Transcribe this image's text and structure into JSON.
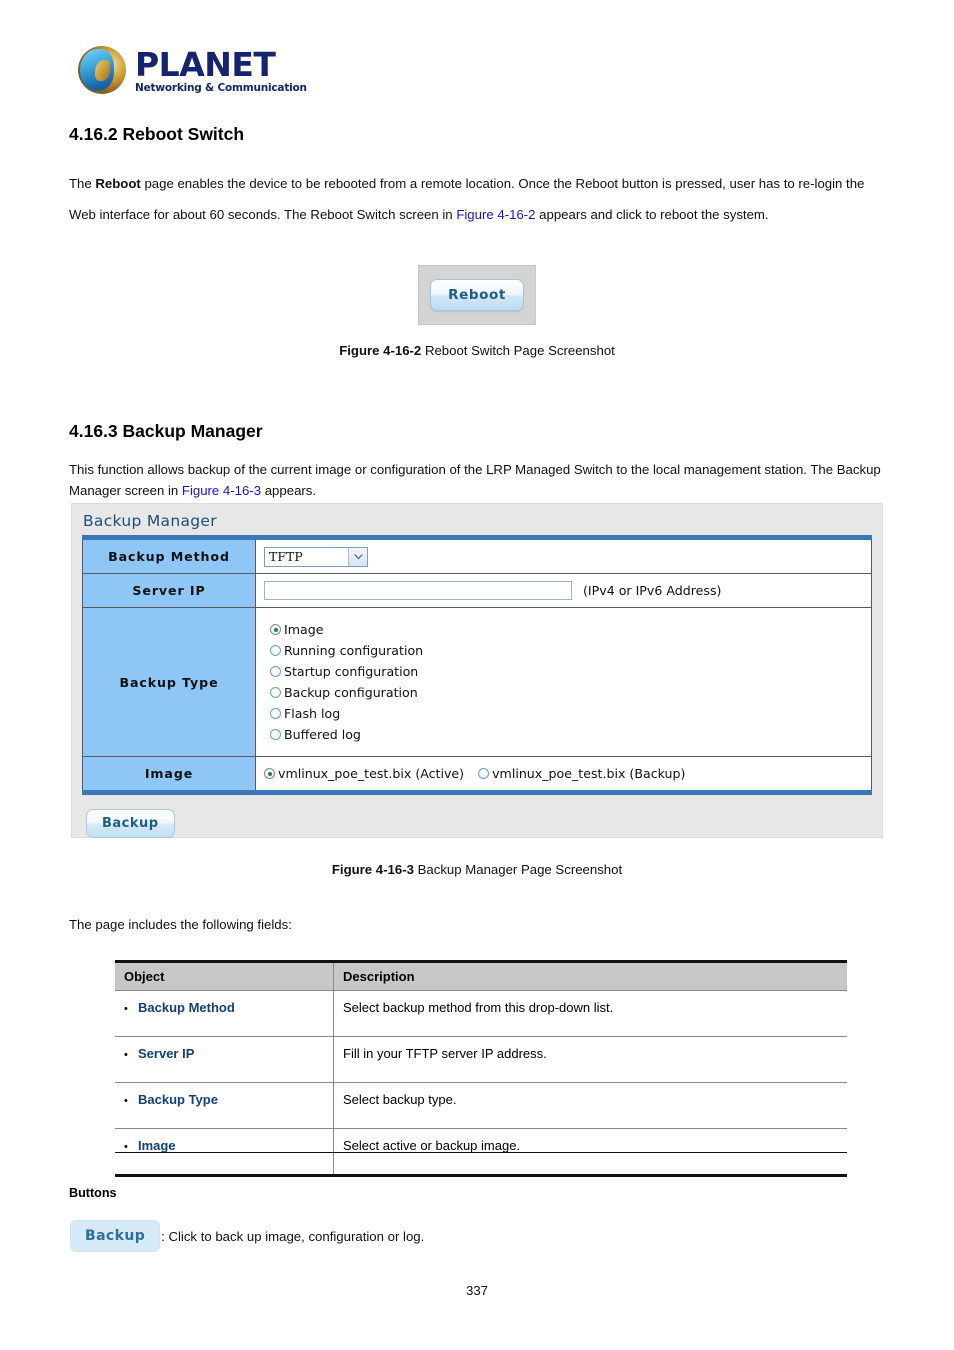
{
  "logo": {
    "wordmark": "PLANET",
    "tagline": "Networking & Communication"
  },
  "sections": {
    "reboot": {
      "heading": "4.16.2 Reboot Switch",
      "paragraph_parts": {
        "p1": "The ",
        "bold1": "Reboot",
        "p2": " page enables the device to be rebooted from a remote location. Once the Reboot button is pressed, user has to re-login the Web interface for about 60 seconds. The Reboot Switch screen in ",
        "link1": "Figure 4-16-2",
        "p3": " appears and click to reboot the system."
      },
      "screenshot": {
        "reboot_button_label": "Reboot"
      },
      "figure_caption_bold": "Figure 4-16-2",
      "figure_caption_rest": " Reboot Switch Page Screenshot"
    },
    "backup": {
      "heading": "4.16.3 Backup Manager",
      "paragraph_parts": {
        "p1": "This function allows backup of the current image or configuration of the LRP Managed Switch to the local management station. The Backup Manager screen in ",
        "link1": "Figure 4-16-3",
        "p2": " appears."
      },
      "figure_caption_bold": "Figure 4-16-3",
      "figure_caption_rest": " Backup Manager Page Screenshot",
      "fields_intro": "The page includes the following fields:"
    }
  },
  "backup_manager_panel": {
    "title": "Backup Manager",
    "rows": {
      "backup_method": {
        "label": "Backup Method",
        "select_value": "TFTP"
      },
      "server_ip": {
        "label": "Server IP",
        "input_value": "",
        "input_placeholder": "",
        "hint": "(IPv4 or IPv6 Address)"
      },
      "backup_type": {
        "label": "Backup Type",
        "options": [
          {
            "label": "Image",
            "selected": true
          },
          {
            "label": "Running configuration",
            "selected": false
          },
          {
            "label": "Startup configuration",
            "selected": false
          },
          {
            "label": "Backup configuration",
            "selected": false
          },
          {
            "label": "Flash log",
            "selected": false
          },
          {
            "label": "Buffered log",
            "selected": false
          }
        ]
      },
      "image": {
        "label": "Image",
        "options": [
          {
            "label": "vmlinux_poe_test.bix (Active)",
            "selected": true
          },
          {
            "label": "vmlinux_poe_test.bix (Backup)",
            "selected": false
          }
        ]
      }
    },
    "backup_button_label": "Backup"
  },
  "fields_table": {
    "headers": {
      "object": "Object",
      "description": "Description"
    },
    "rows": [
      {
        "object": "Backup Method",
        "description": "Select backup method from this drop-down list."
      },
      {
        "object": "Server IP",
        "description": "Fill in your TFTP server IP address."
      },
      {
        "object": "Backup Type",
        "description": "Select backup type."
      },
      {
        "object": "Image",
        "description": "Select active or backup image."
      }
    ]
  },
  "buttons_section": {
    "heading": "Buttons",
    "backup_button_label": "Backup",
    "backup_button_description": ": Click to back up image, configuration or log."
  },
  "footer": {
    "page_number": "337"
  },
  "colors": {
    "link": "#1414dd",
    "panel_label_bg": "#8ec6f5",
    "panel_border_blue": "#3a79b5",
    "object_name": "#12407a",
    "brand": "#14246e"
  }
}
